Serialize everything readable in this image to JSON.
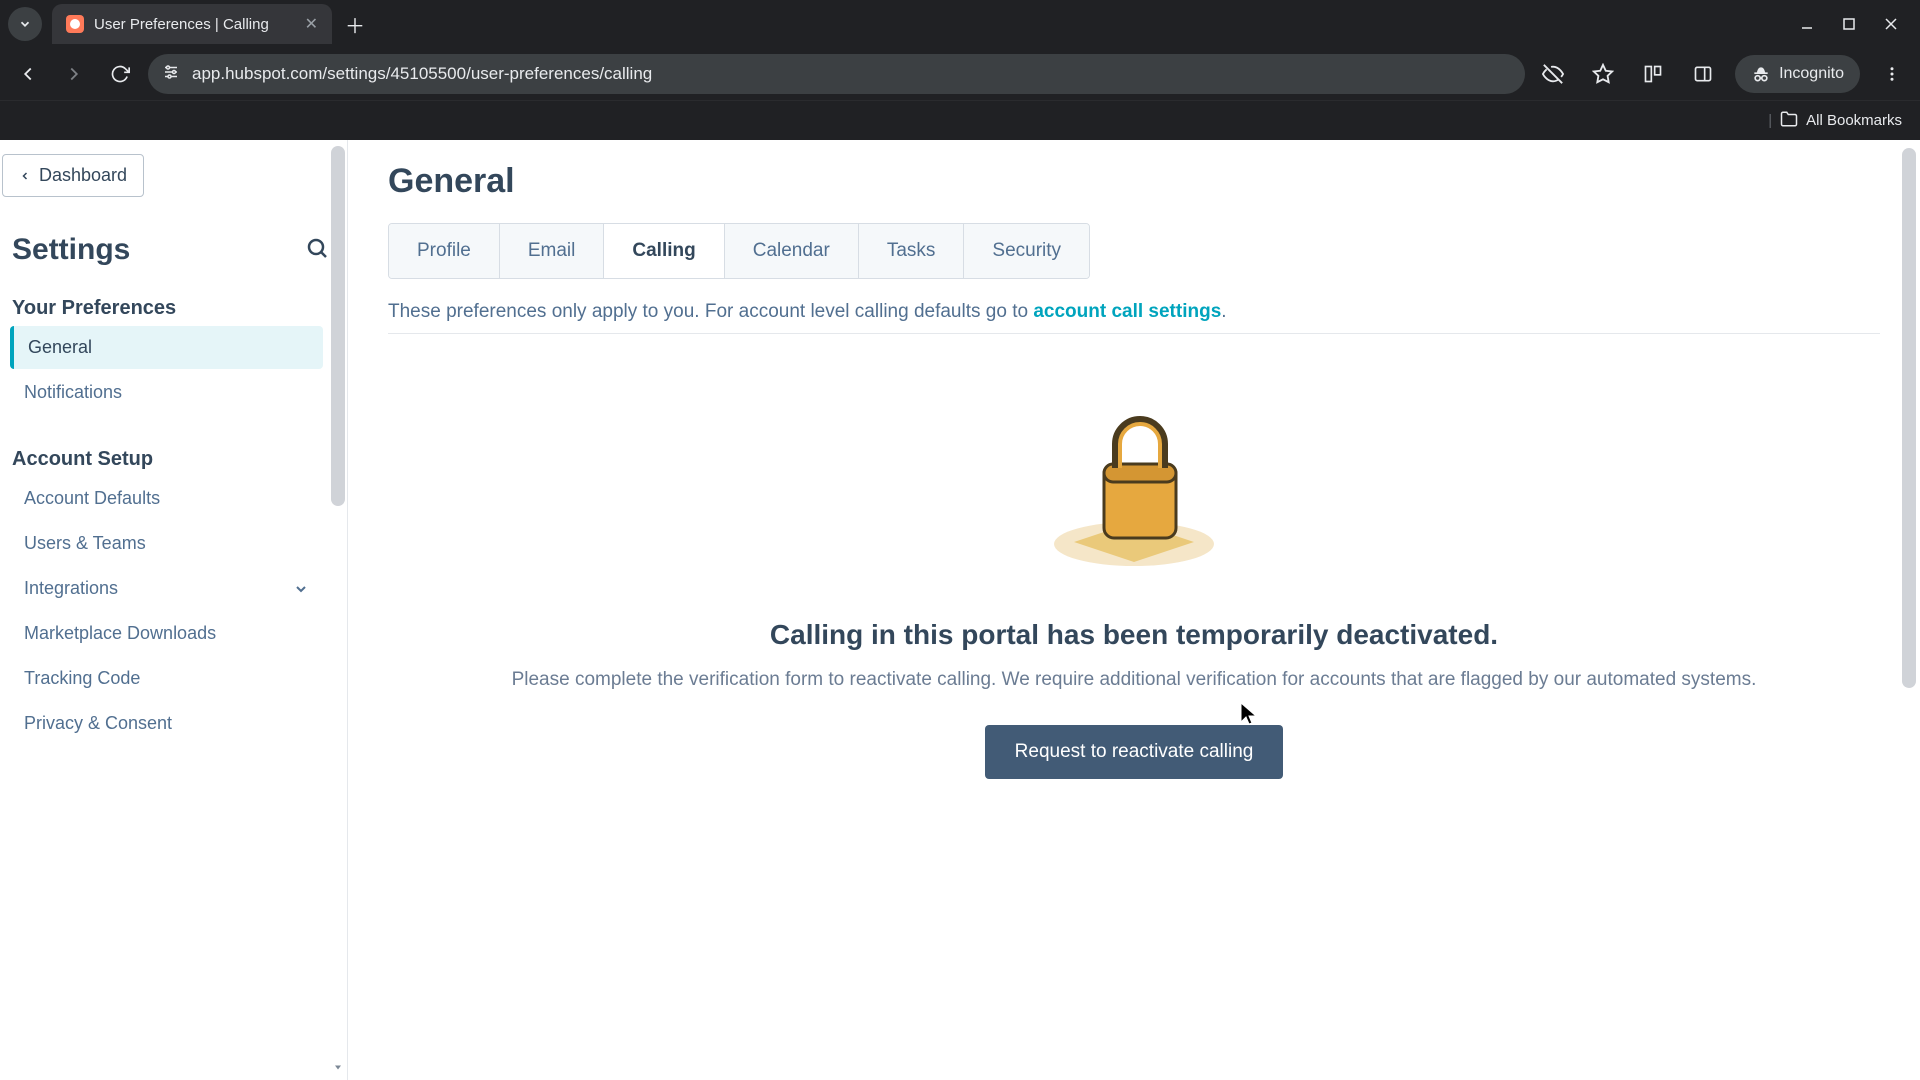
{
  "browser": {
    "tab_title": "User Preferences | Calling",
    "url": "app.hubspot.com/settings/45105500/user-preferences/calling",
    "incognito_label": "Incognito",
    "bookmarks_label": "All Bookmarks"
  },
  "sidebar": {
    "dashboard_label": "Dashboard",
    "settings_label": "Settings",
    "sections": {
      "your_prefs": "Your Preferences",
      "account_setup": "Account Setup"
    },
    "items": {
      "general": "General",
      "notifications": "Notifications",
      "account_defaults": "Account Defaults",
      "users_teams": "Users & Teams",
      "integrations": "Integrations",
      "marketplace": "Marketplace Downloads",
      "tracking": "Tracking Code",
      "privacy": "Privacy & Consent"
    }
  },
  "main": {
    "title": "General",
    "tabs": {
      "profile": "Profile",
      "email": "Email",
      "calling": "Calling",
      "calendar": "Calendar",
      "tasks": "Tasks",
      "security": "Security"
    },
    "note_prefix": "These preferences only apply to you. For account level calling defaults go to ",
    "note_link": "account call settings",
    "note_suffix": ".",
    "empty_heading": "Calling in this portal has been temporarily deactivated.",
    "empty_body": "Please complete the verification form to reactivate calling. We require additional verification for accounts that are flagged by our automated systems.",
    "cta": "Request to reactivate calling"
  }
}
